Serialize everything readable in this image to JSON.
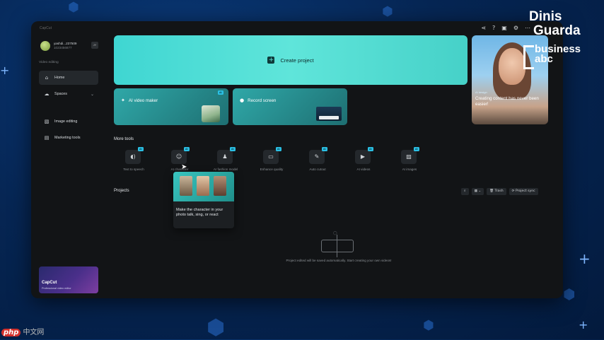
{
  "topbar": {
    "app_name": "CapCut",
    "icons": [
      "share-icon",
      "help-icon",
      "layout-icon",
      "settings-icon",
      "more-icon"
    ]
  },
  "sidebar": {
    "account": {
      "name": "yashdi...237509",
      "sub": "1023456877",
      "badge": "JY"
    },
    "section_label": "Video editing",
    "items": [
      {
        "label": "Home",
        "icon": "home-icon",
        "active": true
      },
      {
        "label": "Spaces",
        "icon": "cloud-icon",
        "active": false,
        "expandable": true
      },
      {
        "label": "Image editing",
        "icon": "image-icon",
        "active": false
      },
      {
        "label": "Marketing tools",
        "icon": "marketing-icon",
        "active": false
      }
    ],
    "promo": {
      "title": "CapCut",
      "subtitle": "Professional video editor"
    }
  },
  "main": {
    "create_label": "Create project",
    "cards": [
      {
        "label": "AI video maker",
        "badge": "AI"
      },
      {
        "label": "Record screen"
      }
    ],
    "hero": {
      "tag": "AI design",
      "text": "Creating content has never been easier!"
    },
    "more_tools_title": "More tools",
    "tools": [
      {
        "label": "Text to speech",
        "badge": "AI",
        "icon": "speech-icon"
      },
      {
        "label": "AI character",
        "badge": "AI",
        "icon": "character-icon"
      },
      {
        "label": "AI fashion model",
        "badge": "AI",
        "icon": "shirt-icon"
      },
      {
        "label": "Enhance quality",
        "badge": "AI",
        "icon": "hd-icon"
      },
      {
        "label": "Auto cutout",
        "badge": "AI",
        "icon": "eraser-icon"
      },
      {
        "label": "AI videos",
        "badge": "AI",
        "icon": "video-icon"
      },
      {
        "label": "AI images",
        "badge": "AI",
        "icon": "image-icon"
      }
    ],
    "tooltip_text": "Make the character in your photo talk, sing, or react",
    "projects_title": "Projects",
    "project_tools": {
      "trash": "Trash",
      "sync": "Project sync"
    },
    "empty_text": "Project edited will be saved automatically. Start creating your own videos!"
  },
  "brand": {
    "line1": "Dinis",
    "line2": "Guarda",
    "line3": "business",
    "line4": "abc"
  },
  "watermark": {
    "php": "php",
    "cn": "中文网"
  },
  "colors": {
    "accent": "#3fd6d2",
    "badge": "#2bc0e4",
    "window_bg": "#121416",
    "page_bg": "#062654"
  }
}
